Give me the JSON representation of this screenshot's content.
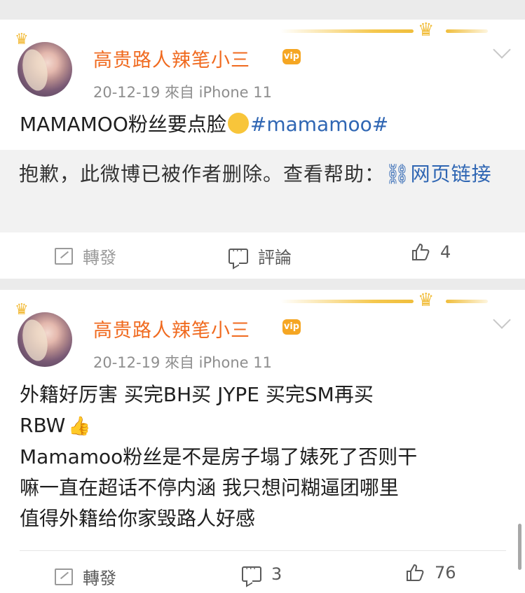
{
  "posts": [
    {
      "username": "高贵路人辣笔小三",
      "vip_badge": "vip",
      "meta": "20-12-19  來自 iPhone 11",
      "text_before_tag": "MAMAMOO粉丝要点脸",
      "emoji_icon": "laughing-emoji-icon",
      "hashtag": "#mamamoo#",
      "deleted_notice": "抱歉，此微博已被作者删除。查看帮助：",
      "deleted_link": "网页链接",
      "actions": {
        "repost": "轉發",
        "comment": "評論",
        "like": "4"
      }
    },
    {
      "username": "高贵路人辣笔小三",
      "vip_badge": "vip",
      "meta": "20-12-19  來自 iPhone 11",
      "line1": "外籍好厉害 买完BH买 JYPE 买完SM再买",
      "line2": "RBW",
      "thumb_emoji_icon": "thumbs-up-emoji-icon",
      "line3": "Mamamoo粉丝是不是房子塌了婊死了否则干",
      "line4": "嘛一直在超话不停内涵 我只想问糊逼团哪里",
      "line5": "值得外籍给你家毁路人好感",
      "actions": {
        "repost": "轉發",
        "comment": "3",
        "like": "76"
      }
    }
  ],
  "colors": {
    "username": "#f06a1f",
    "hashtag": "#2f66b3",
    "crown": "#f1bd3a",
    "background": "#ebebeb"
  }
}
